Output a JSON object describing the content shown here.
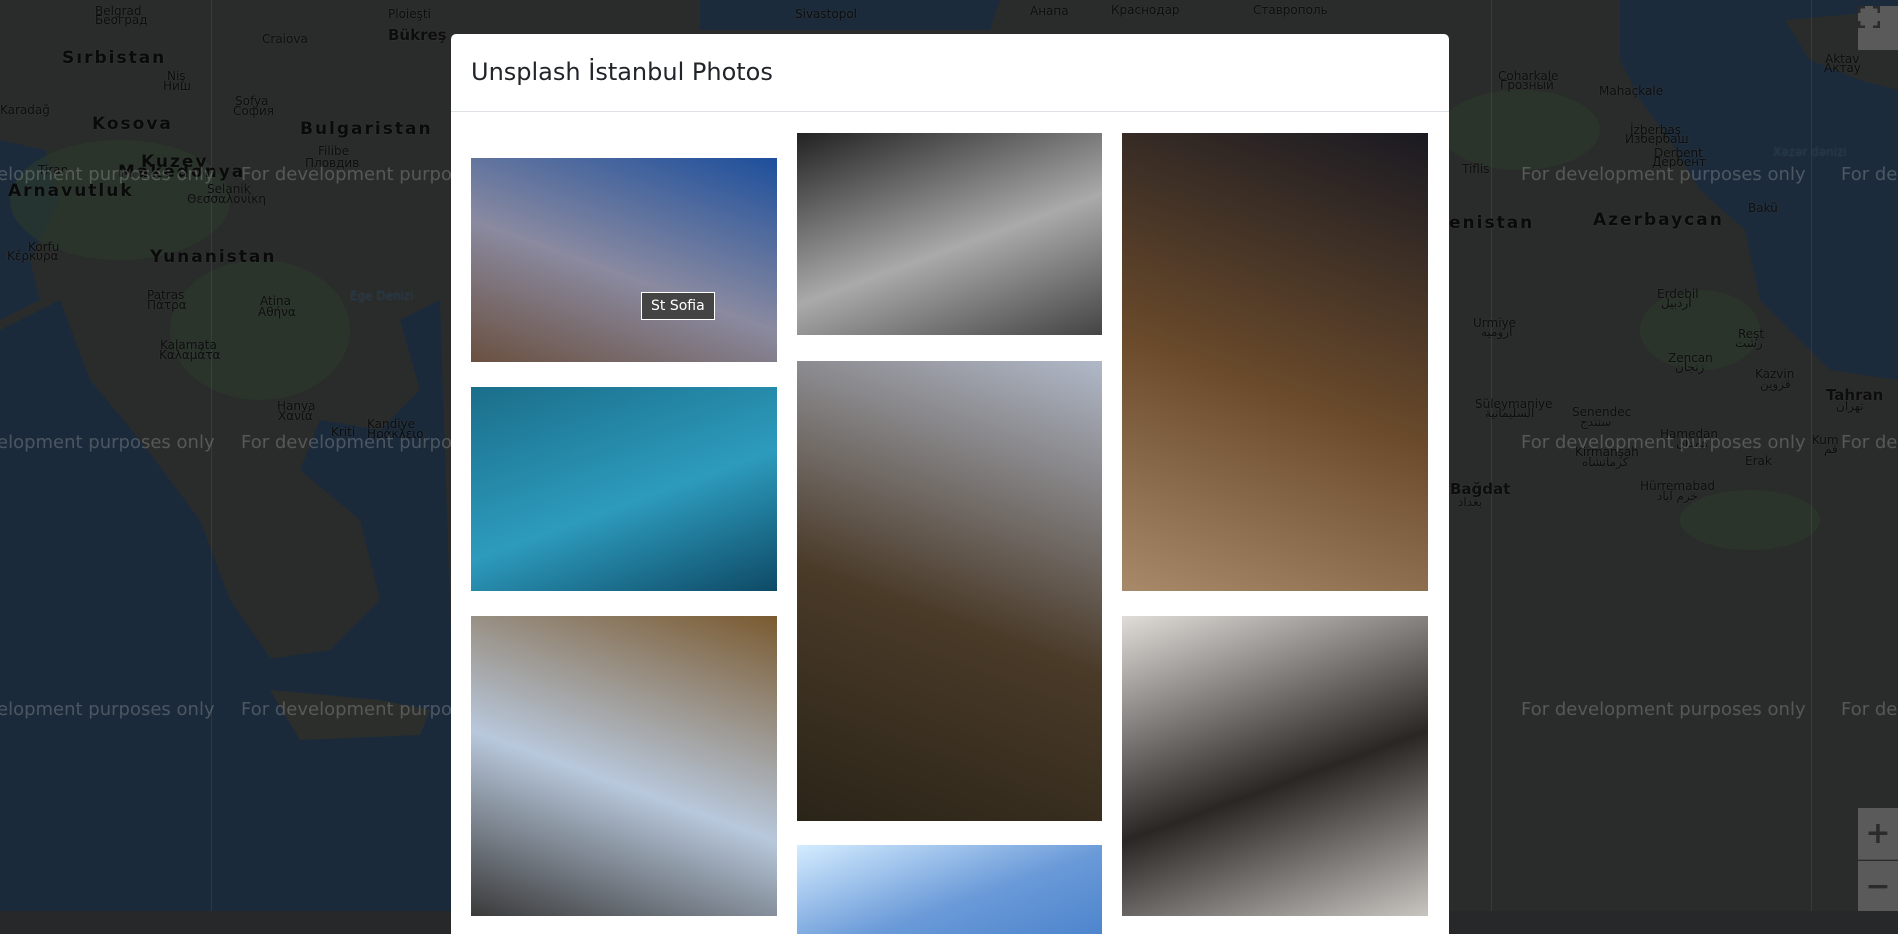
{
  "map": {
    "labels": [
      "Belgrad",
      "Београд",
      "Ploieşti",
      "Bükreş",
      "Sırbistan",
      "Craiova",
      "Niş",
      "Ниш",
      "Sofya",
      "София",
      "Karadağ",
      "Kosova",
      "Bulgaristan",
      "Filibe",
      "Пловдив",
      "Kuzey",
      "Makedonya",
      "Tiran",
      "Arnavutluk",
      "Selanik",
      "Θεσσαλονίκη",
      "Korfu",
      "Κέρκυρα",
      "Yunanistan",
      "Patras",
      "Πάτρα",
      "Atina",
      "Αθήνα",
      "Ege Denizi",
      "Kalamata",
      "Καλαμάτα",
      "Hanya",
      "Χανιά",
      "Kriti",
      "Kandiye",
      "Ηράκλειο",
      "Sivastopol",
      "Анапа",
      "Краснодар",
      "Ставрополь",
      "Coharkale",
      "Грозный",
      "Mahaçkale",
      "İzberbaş",
      "Избербаш",
      "Derbent",
      "Дербент",
      "Tiflis",
      "enistan",
      "Azerbaycan",
      "Bakü",
      "Xəzər dənizi",
      "Erdebil",
      "اردبیل",
      "Urmiye",
      "ارومیه",
      "Reşt",
      "رشت",
      "Zencan",
      "زنجان",
      "Kazvin",
      "قزوین",
      "Tahran",
      "تهران",
      "Süleymaniye",
      "السليمانية",
      "Senendec",
      "سنندج",
      "Hamedan",
      "همدان",
      "Kirmanşah",
      "کرمانشاه",
      "Erak",
      "Hürremabad",
      "خرم آباد",
      "Kum",
      "قم",
      "Bağdat",
      "بغداد",
      "Aktav",
      "Актау"
    ],
    "watermark": "For development purposes only",
    "controls": {
      "fullscreen_icon": "fullscreen-icon",
      "zoom_in_icon": "plus-icon",
      "zoom_out_icon": "minus-icon",
      "zoom_in": "+",
      "zoom_out": "−"
    }
  },
  "modal": {
    "title": "Unsplash İstanbul Photos",
    "tooltip": "St Sofia",
    "photos": [
      {
        "name": "hagia-sophia",
        "colors": [
          "#1d4f9c",
          "#8a8aa0",
          "#6a5040"
        ]
      },
      {
        "name": "boat-on-sea",
        "colors": [
          "#1a6e8a",
          "#2d9bbd",
          "#0e4a66"
        ]
      },
      {
        "name": "narrow-street-buildings",
        "colors": [
          "#7a5a30",
          "#b8c8dc",
          "#3a3a3a"
        ]
      },
      {
        "name": "black-cat",
        "colors": [
          "#222",
          "#aaa",
          "#444"
        ]
      },
      {
        "name": "market-street",
        "colors": [
          "#b0b8c8",
          "#4a3a28",
          "#2a2418"
        ]
      },
      {
        "name": "sky-checkered-flag",
        "colors": [
          "#d4ecff",
          "#6a9ad8",
          "#4a82cc"
        ]
      },
      {
        "name": "galata-tower-night",
        "colors": [
          "#1a1a22",
          "#6a4a2a",
          "#a88a6a"
        ]
      },
      {
        "name": "window-reflection",
        "colors": [
          "#e0dcd8",
          "#2a2624",
          "#c8c4c0"
        ]
      }
    ]
  }
}
